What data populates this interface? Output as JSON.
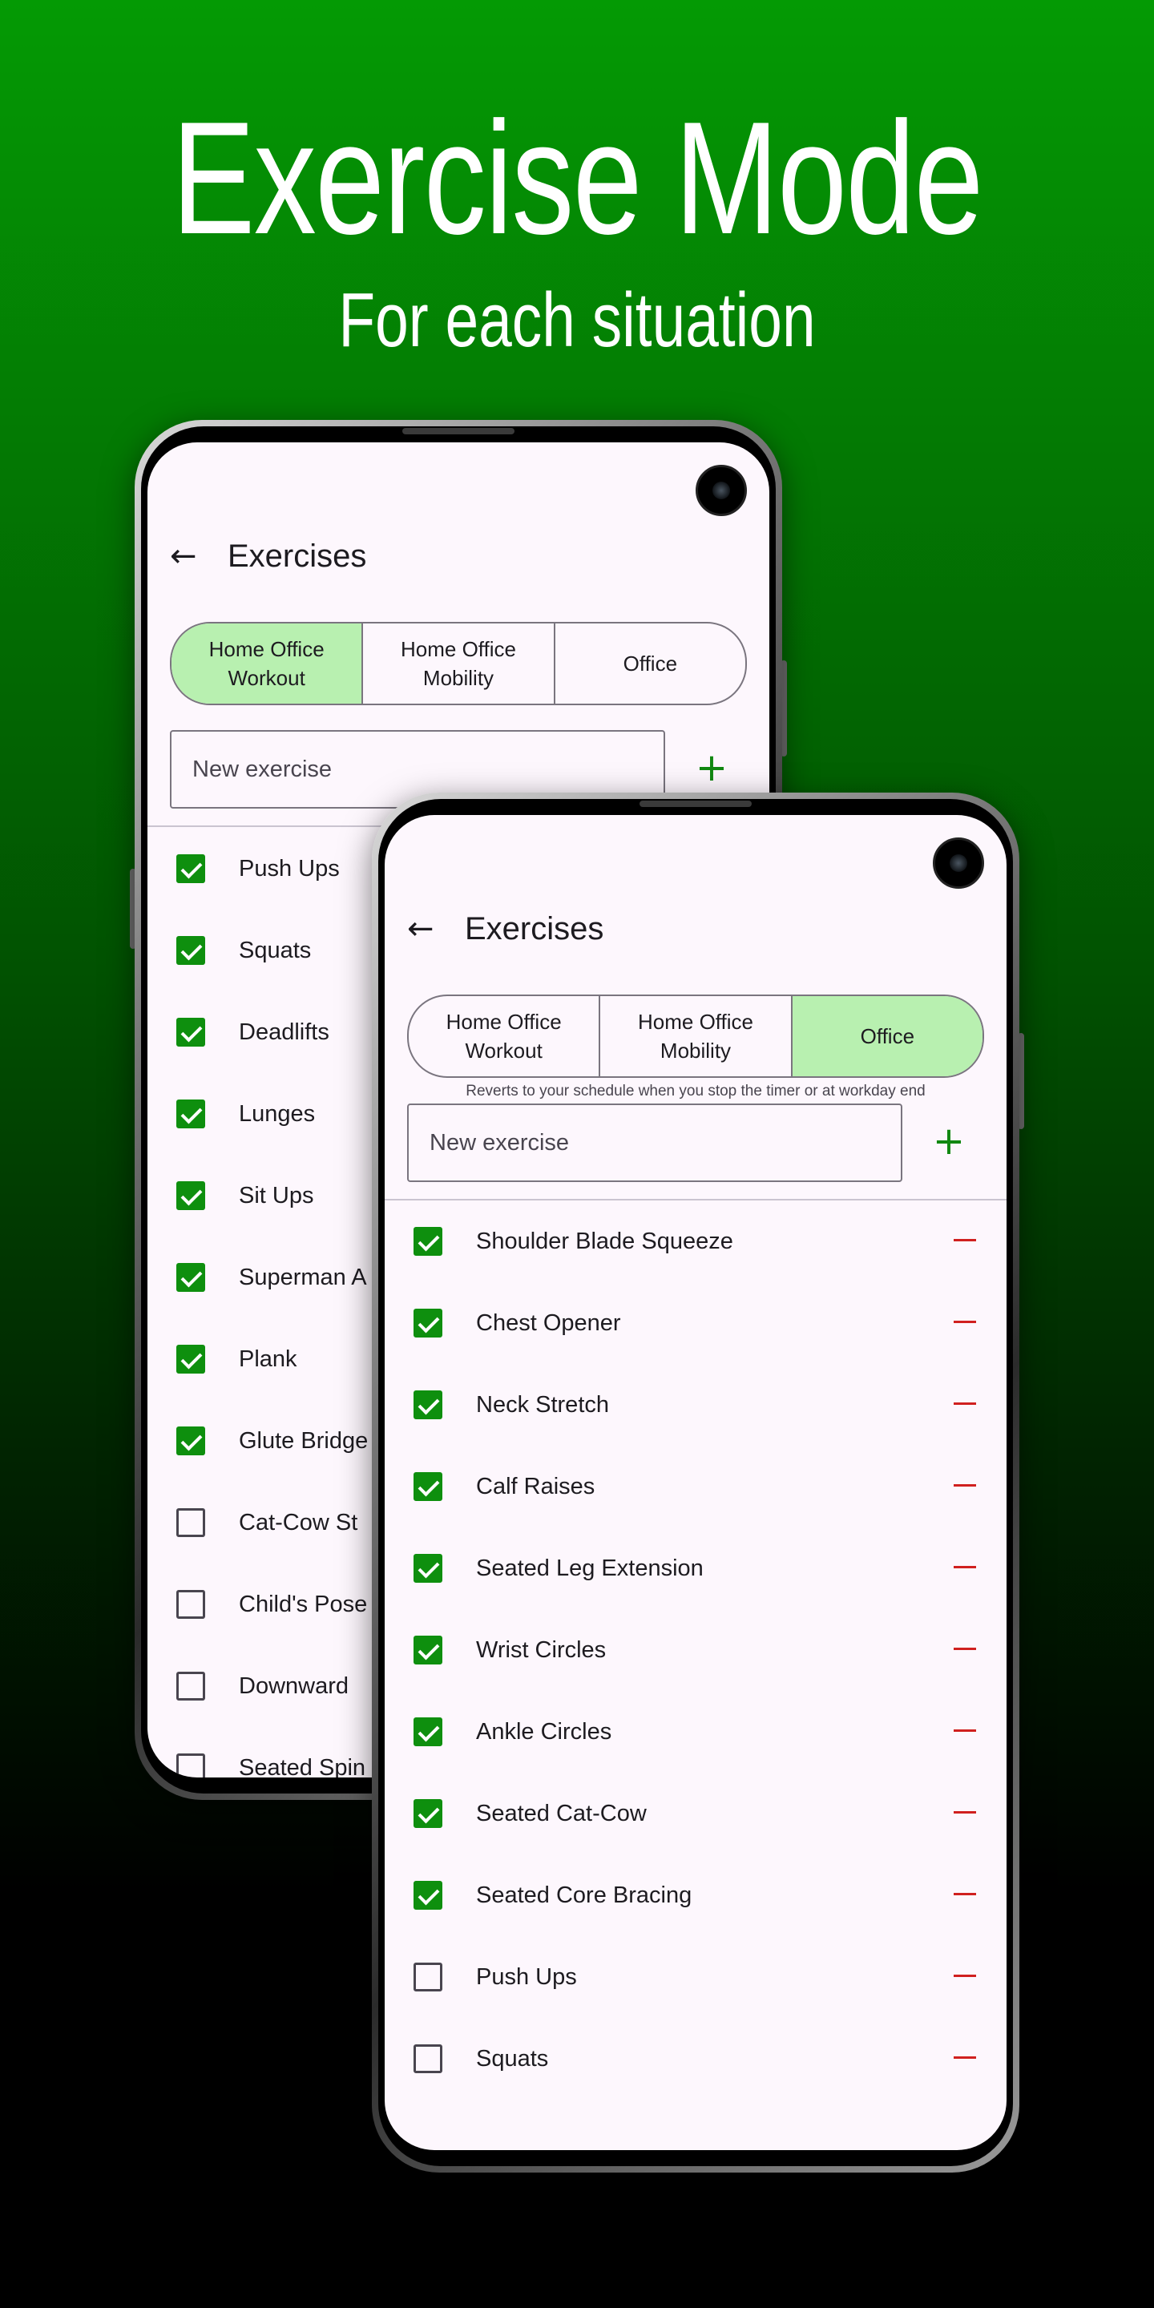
{
  "headline": "Exercise Mode",
  "subheadline": "For each situation",
  "back_phone": {
    "title": "Exercises",
    "segments": [
      {
        "label": "Home Office Workout",
        "selected": true
      },
      {
        "label": "Home Office Mobility",
        "selected": false
      },
      {
        "label": "Office",
        "selected": false
      }
    ],
    "input_placeholder": "New exercise",
    "add_symbol": "+",
    "exercises": [
      {
        "label": "Push Ups",
        "checked": true
      },
      {
        "label": "Squats",
        "checked": true
      },
      {
        "label": "Deadlifts",
        "checked": true
      },
      {
        "label": "Lunges",
        "checked": true
      },
      {
        "label": "Sit Ups",
        "checked": true
      },
      {
        "label": "Superman A",
        "checked": true
      },
      {
        "label": "Plank",
        "checked": true
      },
      {
        "label": "Glute Bridge",
        "checked": true
      },
      {
        "label": "Cat-Cow St",
        "checked": false
      },
      {
        "label": "Child's Pose",
        "checked": false
      },
      {
        "label": "Downward",
        "checked": false
      },
      {
        "label": "Seated Spin",
        "checked": false
      }
    ]
  },
  "front_phone": {
    "title": "Exercises",
    "segments": [
      {
        "label": "Home Office Workout",
        "selected": false
      },
      {
        "label": "Home Office Mobility",
        "selected": false
      },
      {
        "label": "Office",
        "selected": true
      }
    ],
    "hint": "Reverts to your schedule when you stop the timer or at workday end",
    "input_placeholder": "New exercise",
    "add_symbol": "+",
    "exercises": [
      {
        "label": "Shoulder Blade Squeeze",
        "checked": true
      },
      {
        "label": "Chest Opener",
        "checked": true
      },
      {
        "label": "Neck Stretch",
        "checked": true
      },
      {
        "label": "Calf Raises",
        "checked": true
      },
      {
        "label": "Seated Leg Extension",
        "checked": true
      },
      {
        "label": "Wrist Circles",
        "checked": true
      },
      {
        "label": "Ankle Circles",
        "checked": true
      },
      {
        "label": "Seated Cat-Cow",
        "checked": true
      },
      {
        "label": "Seated Core Bracing",
        "checked": true
      },
      {
        "label": "Push Ups",
        "checked": false
      },
      {
        "label": "Squats",
        "checked": false
      }
    ]
  },
  "colors": {
    "accent_green": "#0e8f0e",
    "selected_segment": "#b8f0b0",
    "remove_red": "#d0201f"
  }
}
